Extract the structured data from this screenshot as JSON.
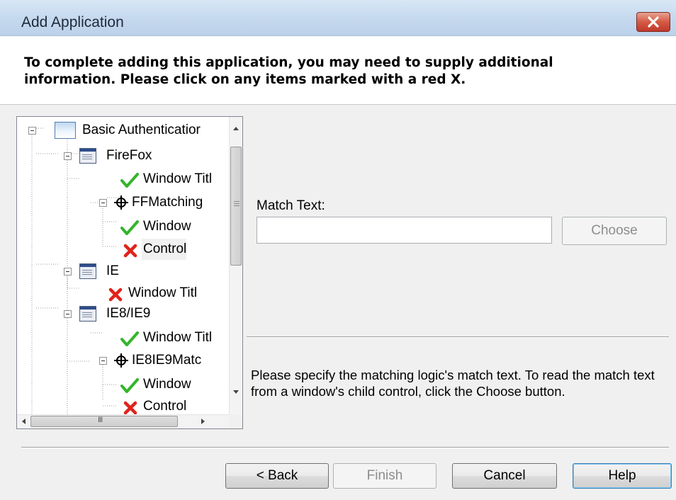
{
  "window": {
    "title": "Add Application"
  },
  "header": {
    "instructions": "To complete adding this application, you may need to supply additional information.  Please click on any items marked with a red X."
  },
  "tree": {
    "nodes": [
      {
        "label": "Basic Authenticatior",
        "icon": "application-icon",
        "status": "none"
      },
      {
        "label": "FireFox",
        "icon": "window-icon",
        "status": "none"
      },
      {
        "label": "Window Titl",
        "icon": "green-check-icon",
        "status": "complete"
      },
      {
        "label": "FFMatching",
        "icon": "crosshair-icon",
        "status": "none"
      },
      {
        "label": "Window",
        "icon": "green-check-icon",
        "status": "complete"
      },
      {
        "label": "Control",
        "icon": "red-x-icon",
        "status": "incomplete"
      },
      {
        "label": "IE",
        "icon": "window-icon",
        "status": "none"
      },
      {
        "label": "Window Titl",
        "icon": "red-x-icon",
        "status": "incomplete"
      },
      {
        "label": "IE8/IE9",
        "icon": "window-icon",
        "status": "none"
      },
      {
        "label": "Window Titl",
        "icon": "green-check-icon",
        "status": "complete"
      },
      {
        "label": "IE8IE9Matc",
        "icon": "crosshair-icon",
        "status": "none"
      },
      {
        "label": "Window",
        "icon": "green-check-icon",
        "status": "complete"
      },
      {
        "label": "Control",
        "icon": "red-x-icon",
        "status": "incomplete"
      }
    ],
    "hscroll_glyph": "III"
  },
  "match": {
    "label": "Match Text:",
    "value": "",
    "choose_label": "Choose"
  },
  "description": "Please specify the matching logic's match text.  To read the match text from a window's child control, click the Choose button.",
  "buttons": {
    "back": "< Back",
    "finish": "Finish",
    "cancel": "Cancel",
    "help": "Help"
  },
  "colors": {
    "check": "#33b529",
    "x": "#e0231a",
    "titlebar": "#c9dcf0",
    "close": "#d45a44"
  }
}
